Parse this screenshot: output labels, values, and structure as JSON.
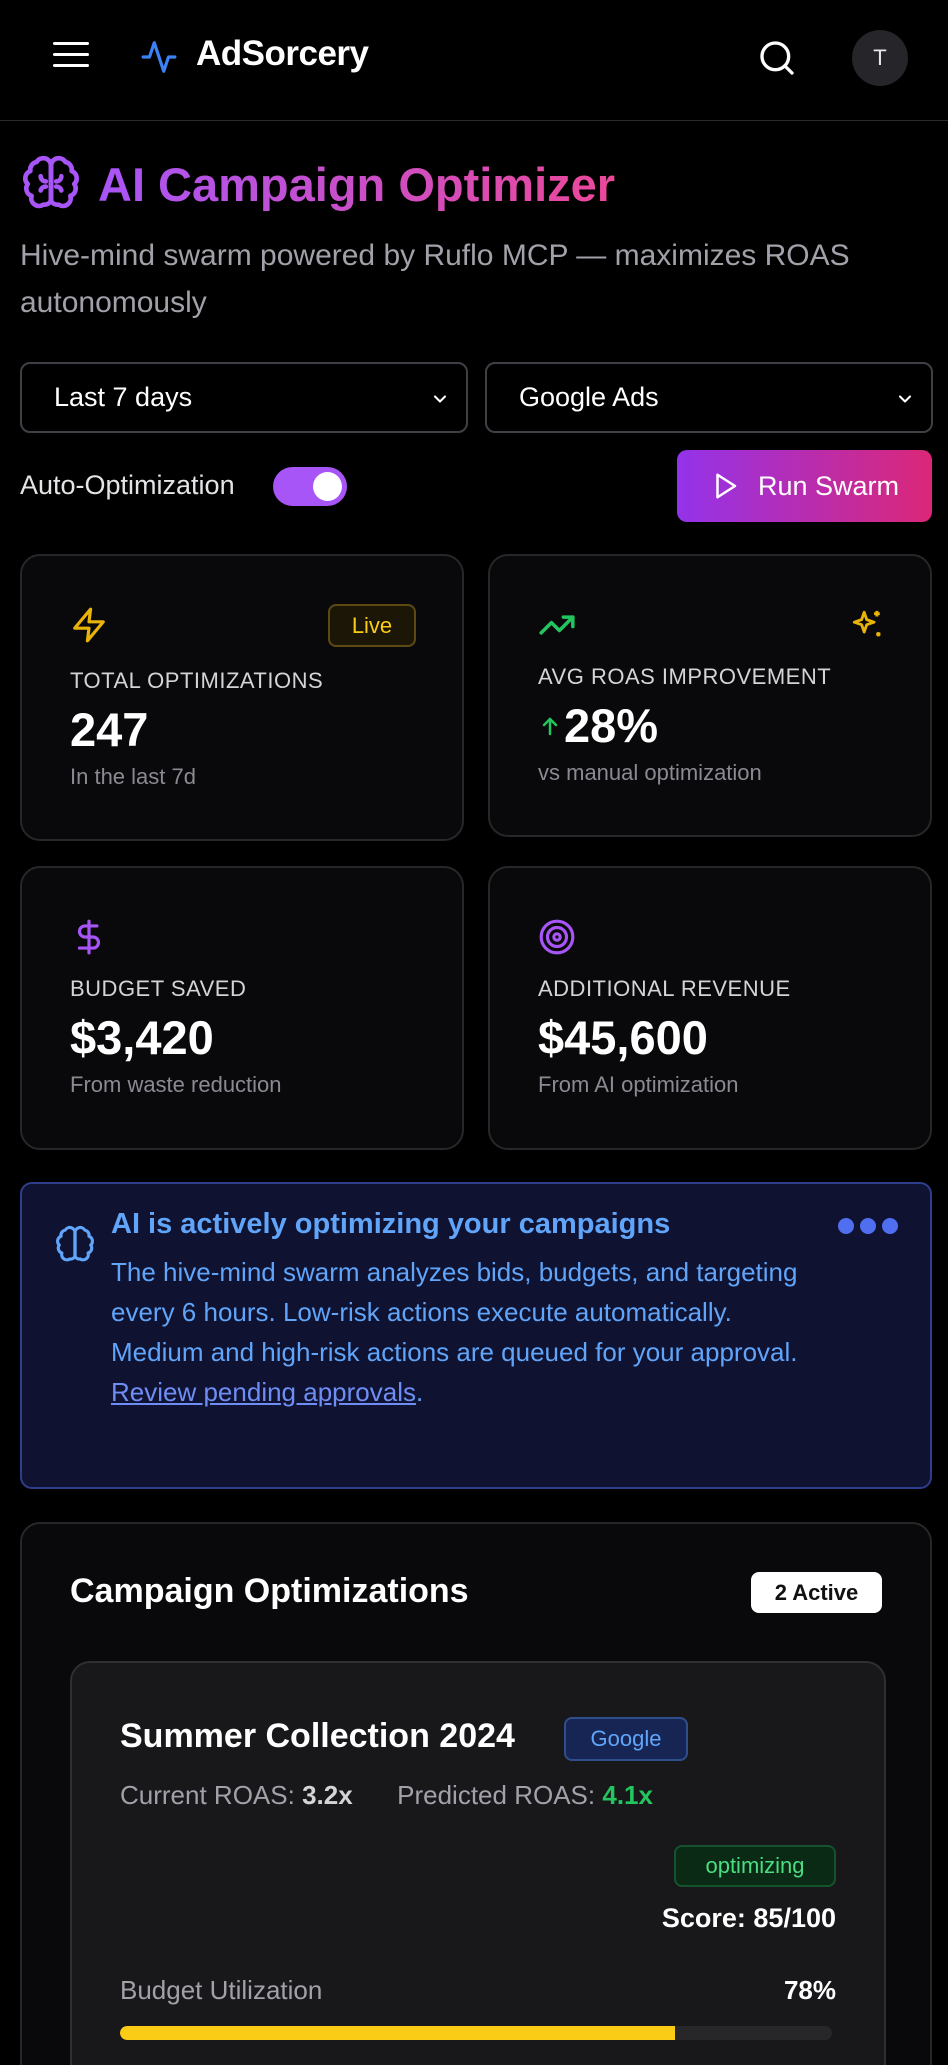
{
  "header": {
    "brand": "AdSorcery",
    "avatar_initial": "T",
    "icons": [
      "menu-icon",
      "activity-icon",
      "search-icon"
    ]
  },
  "page": {
    "title": "AI Campaign Optimizer",
    "subtitle": "Hive-mind swarm powered by Ruflo MCP — maximizes ROAS autonomously"
  },
  "filters": {
    "date_range": {
      "selected": "Last 7 days"
    },
    "platform": {
      "selected": "Google Ads"
    }
  },
  "controls": {
    "auto_optimization_label": "Auto-Optimization",
    "auto_optimization_on": true,
    "run_button_label": "Run Swarm"
  },
  "stats": [
    {
      "label": "TOTAL OPTIMIZATIONS",
      "value": "247",
      "note": "In the last 7d",
      "badge": "Live",
      "icon": "zap-icon",
      "color": "#eab308"
    },
    {
      "label": "AVG ROAS IMPROVEMENT",
      "value": "28%",
      "note": "vs manual optimization",
      "icon": "trending-up-icon",
      "color": "#22c55e"
    },
    {
      "label": "BUDGET SAVED",
      "value": "$3,420",
      "note": "From waste reduction",
      "icon": "dollar-icon",
      "color": "#a855f7"
    },
    {
      "label": "ADDITIONAL REVENUE",
      "value": "$45,600",
      "note": "From AI optimization",
      "icon": "target-icon",
      "color": "#a855f7"
    }
  ],
  "info": {
    "title": "AI is actively optimizing your campaigns",
    "body": "The hive-mind swarm analyzes bids, budgets, and targeting every 6 hours. Low-risk actions execute automatically. Medium and high-risk actions are queued for your approval.",
    "link_text": "Review pending approvals",
    "link_suffix": "."
  },
  "optimizations": {
    "title": "Campaign Optimizations",
    "active_badge": "2 Active",
    "campaigns": [
      {
        "name": "Summer Collection 2024",
        "platform": "Google",
        "current_roas_label": "Current ROAS:",
        "current_roas": "3.2x",
        "predicted_roas_label": "Predicted ROAS:",
        "predicted_roas": "4.1x",
        "status": "optimizing",
        "score_text": "Score: 85/100",
        "budget_label": "Budget Utilization",
        "budget_pct_text": "78%",
        "budget_utilization": 0.78
      }
    ]
  },
  "colors": {
    "accent_purple": "#a855f7",
    "accent_pink": "#ec4899",
    "info_blue": "#60a5fa",
    "success_green": "#22c55e",
    "warning_yellow": "#facc15"
  }
}
